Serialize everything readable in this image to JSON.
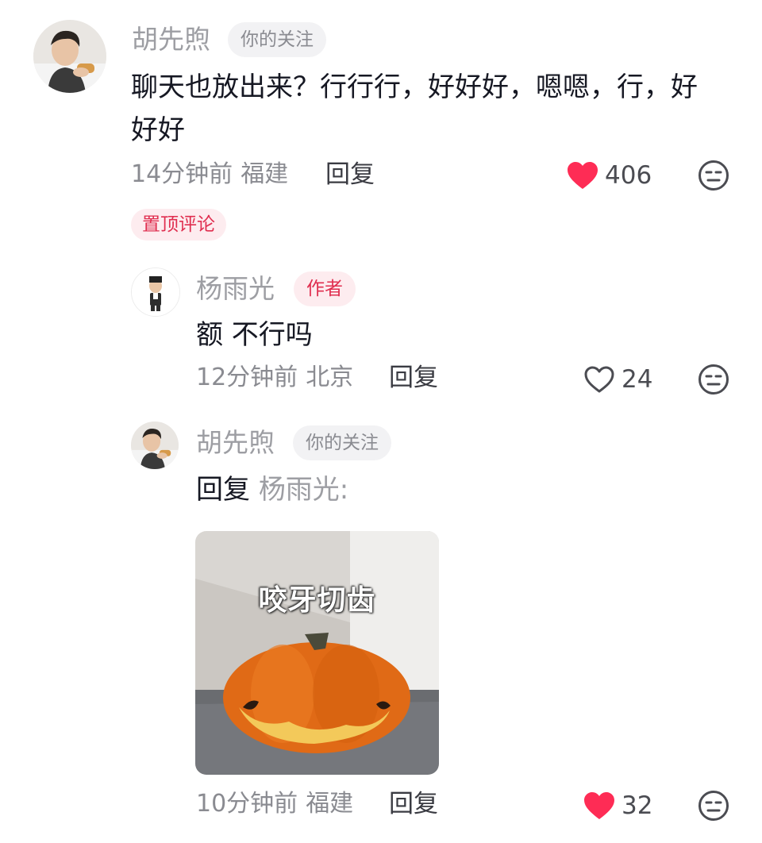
{
  "comments": [
    {
      "author": "胡先煦",
      "tag": "你的关注",
      "text": "聊天也放出来？行行行，好好好，嗯嗯，行，好好好",
      "time": "14分钟前",
      "location": "福建",
      "reply_label": "回复",
      "likes": "406",
      "liked": true,
      "pinned_label": "置顶评论"
    }
  ],
  "replies": [
    {
      "author": "杨雨光",
      "tag": "作者",
      "text": "额 不行吗",
      "time": "12分钟前",
      "location": "北京",
      "reply_label": "回复",
      "likes": "24",
      "liked": false
    },
    {
      "author": "胡先煦",
      "tag": "你的关注",
      "reply_prefix": "回复",
      "reply_to": "杨雨光:",
      "sticker_caption": "咬牙切齿",
      "time": "10分钟前",
      "location": "福建",
      "reply_label": "回复",
      "likes": "32",
      "liked": true
    }
  ],
  "colors": {
    "like_red": "#fe2c55",
    "tag_red": "#e02e4f",
    "muted": "#9d9ea3",
    "text": "#161823"
  },
  "icons": [
    "heart-icon",
    "heart-outline-icon",
    "dislike-face-icon"
  ]
}
